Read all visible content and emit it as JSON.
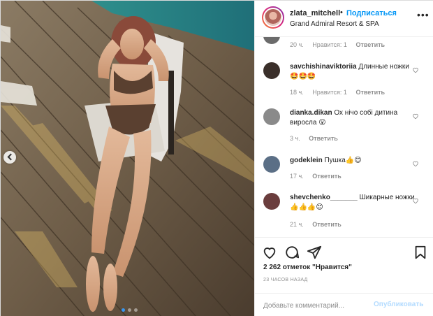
{
  "header": {
    "username": "zlata_mitchell",
    "separator": "•",
    "follow_label": "Подписаться",
    "location": "Grand Admiral Resort & SPA",
    "more_label": "•••"
  },
  "comments": [
    {
      "username": "",
      "text": "",
      "time": "20 ч.",
      "likes": "Нравится: 1",
      "reply": "Ответить"
    },
    {
      "username": "savchishinaviktoriia",
      "text": "Длинные ножки🤩🤩🤩",
      "time": "18 ч.",
      "likes": "Нравится: 1",
      "reply": "Ответить"
    },
    {
      "username": "dianka.dikan",
      "text": "Ох нічо собі дитина виросла 😮",
      "time": "3 ч.",
      "likes": "",
      "reply": "Ответить"
    },
    {
      "username": "godeklein",
      "text": "Пушка👍😊",
      "time": "17 ч.",
      "likes": "",
      "reply": "Ответить"
    },
    {
      "username": "shevchenko_______",
      "text": "Шикарные ножки👍👍👍😊",
      "time": "21 ч.",
      "likes": "",
      "reply": "Ответить"
    }
  ],
  "actions": {
    "likes_text": "2 262 отметок \"Нравится\"",
    "time_ago": "23 ЧАСОВ НАЗАД"
  },
  "add_comment": {
    "placeholder": "Добавьте комментарий...",
    "post_label": "Опубликовать"
  },
  "carousel": {
    "slides": 3,
    "active_index": 0
  },
  "colors": {
    "accent": "#0095f6",
    "post_disabled": "#b3dbff",
    "meta": "#8e8e8e",
    "text": "#262626"
  },
  "icons": [
    "heart-icon",
    "comment-icon",
    "share-icon",
    "bookmark-icon",
    "more-icon",
    "chevron-left-icon"
  ]
}
